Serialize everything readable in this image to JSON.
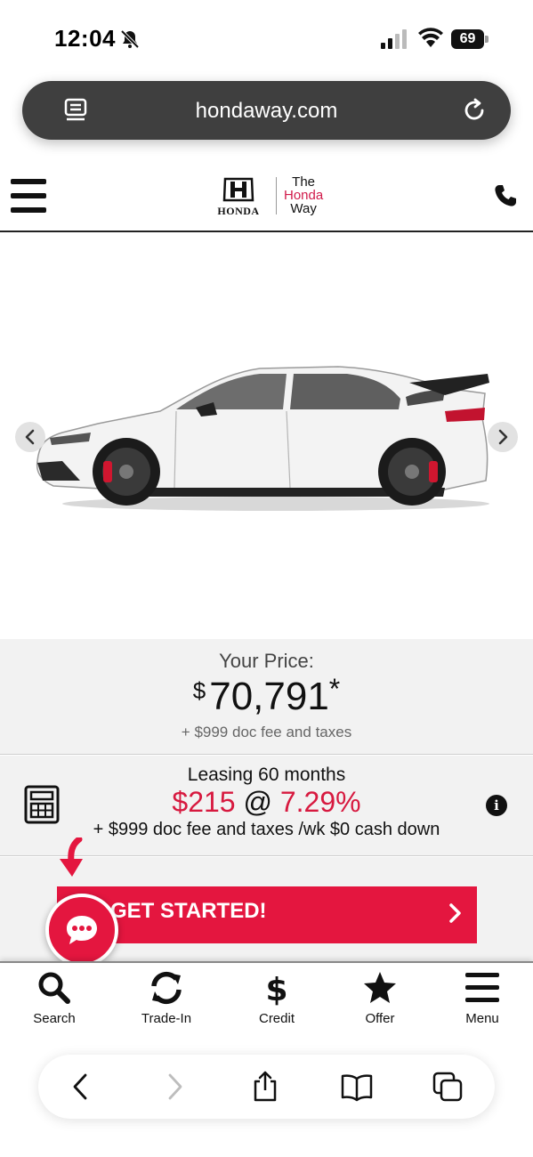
{
  "status_bar": {
    "time": "12:04",
    "battery": "69"
  },
  "browser": {
    "url": "hondaway.com"
  },
  "header": {
    "brand": "HONDA",
    "tagline": [
      "The",
      "Honda",
      "Way"
    ]
  },
  "price": {
    "label": "Your Price:",
    "currency": "$",
    "amount": "70,791",
    "asterisk": "*",
    "note": "+ $999 doc fee and taxes"
  },
  "lease": {
    "term": "Leasing 60 months",
    "payment": "$215",
    "at": "@",
    "rate": "7.29%",
    "note": "+ $999 doc fee and taxes /wk $0 cash down"
  },
  "cta": {
    "label": "GET STARTED!"
  },
  "bottom_nav": {
    "search": "Search",
    "trade_in": "Trade-In",
    "credit": "Credit",
    "offer": "Offer",
    "menu": "Menu"
  },
  "colors": {
    "accent": "#e4163f",
    "brand_red": "#d11a4a"
  }
}
